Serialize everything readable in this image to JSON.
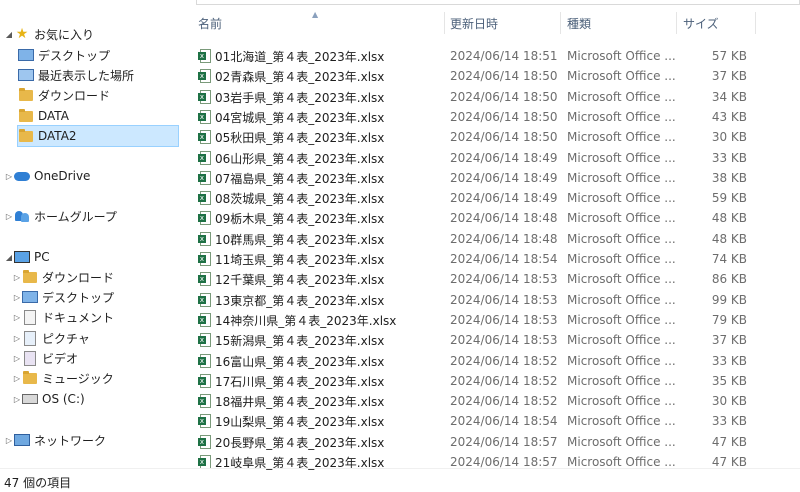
{
  "sidebar": {
    "favorites": {
      "label": "お気に入り",
      "icon": "star-icon"
    },
    "favorite_items": [
      {
        "label": "デスクトップ",
        "icon": "desktop-icon"
      },
      {
        "label": "最近表示した場所",
        "icon": "recent-places-icon"
      },
      {
        "label": "ダウンロード",
        "icon": "downloads-icon"
      },
      {
        "label": "DATA",
        "icon": "folder-icon"
      },
      {
        "label": "DATA2",
        "icon": "folder-icon",
        "selected": true
      }
    ],
    "onedrive": {
      "label": "OneDrive",
      "icon": "onedrive-icon"
    },
    "homegroup": {
      "label": "ホームグループ",
      "icon": "homegroup-icon"
    },
    "pc": {
      "label": "PC",
      "icon": "pc-icon"
    },
    "pc_items": [
      {
        "label": "ダウンロード",
        "icon": "downloads-icon"
      },
      {
        "label": "デスクトップ",
        "icon": "desktop-icon"
      },
      {
        "label": "ドキュメント",
        "icon": "documents-icon"
      },
      {
        "label": "ピクチャ",
        "icon": "pictures-icon"
      },
      {
        "label": "ビデオ",
        "icon": "videos-icon"
      },
      {
        "label": "ミュージック",
        "icon": "music-icon"
      },
      {
        "label": "OS (C:)",
        "icon": "drive-icon"
      }
    ],
    "network": {
      "label": "ネットワーク",
      "icon": "network-icon"
    }
  },
  "columns": {
    "name": "名前",
    "date": "更新日時",
    "type": "種類",
    "size": "サイズ"
  },
  "files": [
    {
      "name": "01北海道_第４表_2023年.xlsx",
      "date": "2024/06/14 18:51",
      "type": "Microsoft Office ...",
      "size": "57 KB"
    },
    {
      "name": "02青森県_第４表_2023年.xlsx",
      "date": "2024/06/14 18:50",
      "type": "Microsoft Office ...",
      "size": "37 KB"
    },
    {
      "name": "03岩手県_第４表_2023年.xlsx",
      "date": "2024/06/14 18:50",
      "type": "Microsoft Office ...",
      "size": "34 KB"
    },
    {
      "name": "04宮城県_第４表_2023年.xlsx",
      "date": "2024/06/14 18:50",
      "type": "Microsoft Office ...",
      "size": "43 KB"
    },
    {
      "name": "05秋田県_第４表_2023年.xlsx",
      "date": "2024/06/14 18:50",
      "type": "Microsoft Office ...",
      "size": "30 KB"
    },
    {
      "name": "06山形県_第４表_2023年.xlsx",
      "date": "2024/06/14 18:49",
      "type": "Microsoft Office ...",
      "size": "33 KB"
    },
    {
      "name": "07福島県_第４表_2023年.xlsx",
      "date": "2024/06/14 18:49",
      "type": "Microsoft Office ...",
      "size": "38 KB"
    },
    {
      "name": "08茨城県_第４表_2023年.xlsx",
      "date": "2024/06/14 18:49",
      "type": "Microsoft Office ...",
      "size": "59 KB"
    },
    {
      "name": "09栃木県_第４表_2023年.xlsx",
      "date": "2024/06/14 18:48",
      "type": "Microsoft Office ...",
      "size": "48 KB"
    },
    {
      "name": "10群馬県_第４表_2023年.xlsx",
      "date": "2024/06/14 18:48",
      "type": "Microsoft Office ...",
      "size": "48 KB"
    },
    {
      "name": "11埼玉県_第４表_2023年.xlsx",
      "date": "2024/06/14 18:54",
      "type": "Microsoft Office ...",
      "size": "74 KB"
    },
    {
      "name": "12千葉県_第４表_2023年.xlsx",
      "date": "2024/06/14 18:53",
      "type": "Microsoft Office ...",
      "size": "86 KB"
    },
    {
      "name": "13東京都_第４表_2023年.xlsx",
      "date": "2024/06/14 18:53",
      "type": "Microsoft Office ...",
      "size": "99 KB"
    },
    {
      "name": "14神奈川県_第４表_2023年.xlsx",
      "date": "2024/06/14 18:53",
      "type": "Microsoft Office ...",
      "size": "79 KB"
    },
    {
      "name": "15新潟県_第４表_2023年.xlsx",
      "date": "2024/06/14 18:53",
      "type": "Microsoft Office ...",
      "size": "37 KB"
    },
    {
      "name": "16富山県_第４表_2023年.xlsx",
      "date": "2024/06/14 18:52",
      "type": "Microsoft Office ...",
      "size": "33 KB"
    },
    {
      "name": "17石川県_第４表_2023年.xlsx",
      "date": "2024/06/14 18:52",
      "type": "Microsoft Office ...",
      "size": "35 KB"
    },
    {
      "name": "18福井県_第４表_2023年.xlsx",
      "date": "2024/06/14 18:52",
      "type": "Microsoft Office ...",
      "size": "30 KB"
    },
    {
      "name": "19山梨県_第４表_2023年.xlsx",
      "date": "2024/06/14 18:54",
      "type": "Microsoft Office ...",
      "size": "33 KB"
    },
    {
      "name": "20長野県_第４表_2023年.xlsx",
      "date": "2024/06/14 18:57",
      "type": "Microsoft Office ...",
      "size": "47 KB"
    },
    {
      "name": "21岐阜県_第４表_2023年.xlsx",
      "date": "2024/06/14 18:57",
      "type": "Microsoft Office ...",
      "size": "47 KB"
    }
  ],
  "status": {
    "item_count": "47 個の項目"
  }
}
